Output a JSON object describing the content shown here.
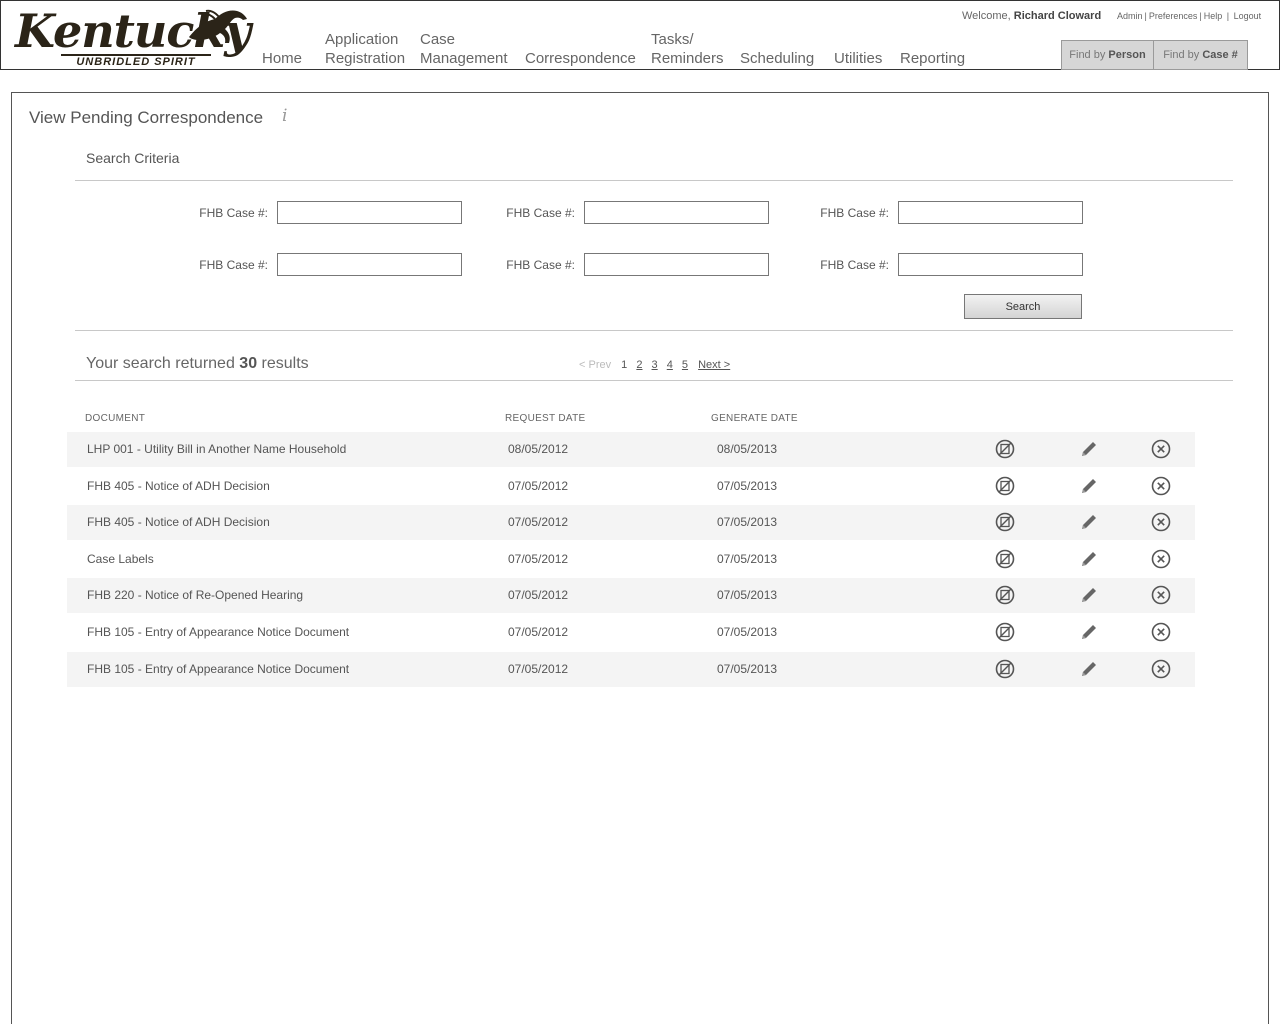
{
  "header": {
    "logo": {
      "word": "Kentucky",
      "tagline": "UNBRIDLED SPIRIT"
    },
    "nav": [
      {
        "id": "home",
        "line1": "",
        "line2": "Home"
      },
      {
        "id": "application-registration",
        "line1": "Application",
        "line2": "Registration"
      },
      {
        "id": "case-management",
        "line1": "Case",
        "line2": "Management"
      },
      {
        "id": "correspondence",
        "line1": "",
        "line2": "Correspondence"
      },
      {
        "id": "tasks-reminders",
        "line1": "Tasks/",
        "line2": "Reminders"
      },
      {
        "id": "scheduling",
        "line1": "",
        "line2": "Scheduling"
      },
      {
        "id": "utilities",
        "line1": "",
        "line2": "Utilities"
      },
      {
        "id": "reporting",
        "line1": "",
        "line2": "Reporting"
      }
    ],
    "welcome_prefix": "Welcome,",
    "user_name": "Richard Cloward",
    "links": {
      "admin": "Admin",
      "preferences": "Preferences",
      "help": "Help",
      "logout": "Logout"
    },
    "find_person": {
      "prefix": "Find by",
      "bold": "Person"
    },
    "find_case": {
      "prefix": "Find by",
      "bold": "Case #"
    }
  },
  "page": {
    "title": "View Pending Correspondence",
    "info_glyph": "i"
  },
  "search": {
    "section_title": "Search Criteria",
    "fields": [
      {
        "label": "FHB Case #:",
        "value": ""
      },
      {
        "label": "FHB Case #:",
        "value": ""
      },
      {
        "label": "FHB Case #:",
        "value": ""
      },
      {
        "label": "FHB Case #:",
        "value": ""
      },
      {
        "label": "FHB Case #:",
        "value": ""
      },
      {
        "label": "FHB Case #:",
        "value": ""
      }
    ],
    "button_label": "Search"
  },
  "results": {
    "prefix": "Your search returned",
    "count": "30",
    "suffix": "results",
    "pager": {
      "prev": "< Prev",
      "pages": [
        "1",
        "2",
        "3",
        "4",
        "5"
      ],
      "next": "Next >"
    },
    "columns": {
      "document": "DOCUMENT",
      "request_date": "REQUEST DATE",
      "generate_date": "GENERATE DATE"
    },
    "rows": [
      {
        "document": "LHP 001 - Utility Bill in Another Name Household",
        "request_date": "08/05/2012",
        "generate_date": "08/05/2013"
      },
      {
        "document": "FHB 405 - Notice of ADH Decision",
        "request_date": "07/05/2012",
        "generate_date": "07/05/2013"
      },
      {
        "document": "FHB 405 - Notice of ADH Decision",
        "request_date": "07/05/2012",
        "generate_date": "07/05/2013"
      },
      {
        "document": "Case Labels",
        "request_date": "07/05/2012",
        "generate_date": "07/05/2013"
      },
      {
        "document": "FHB 220 - Notice of Re-Opened Hearing",
        "request_date": "07/05/2012",
        "generate_date": "07/05/2013"
      },
      {
        "document": "FHB 105 - Entry of Appearance Notice Document",
        "request_date": "07/05/2012",
        "generate_date": "07/05/2013"
      },
      {
        "document": "FHB 105 - Entry of Appearance Notice Document",
        "request_date": "07/05/2012",
        "generate_date": "07/05/2013"
      }
    ],
    "row_icons": [
      "view-document-icon",
      "edit-pencil-icon",
      "delete-circle-x-icon"
    ]
  }
}
